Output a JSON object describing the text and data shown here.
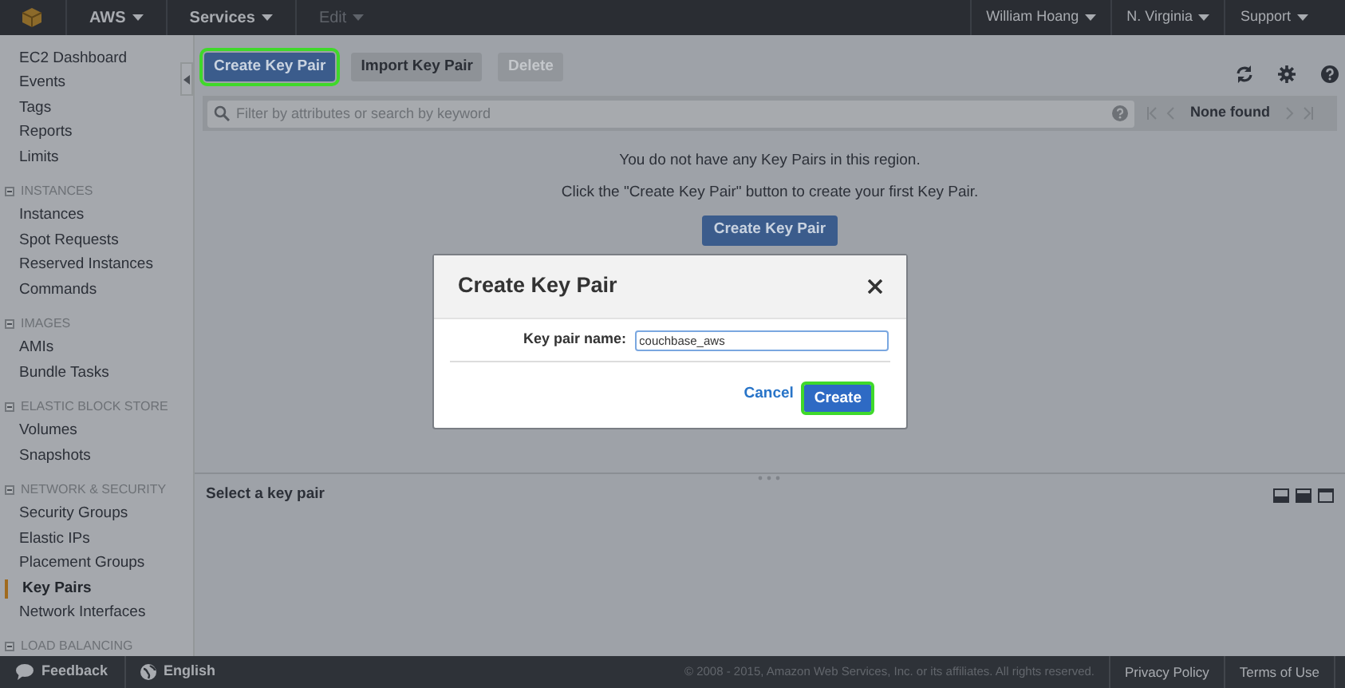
{
  "topbar": {
    "menus": [
      {
        "label": "AWS",
        "disabled": false
      },
      {
        "label": "Services",
        "disabled": false
      },
      {
        "label": "Edit",
        "disabled": true
      }
    ],
    "right_menus": [
      "William Hoang",
      "N. Virginia",
      "Support"
    ]
  },
  "sidebar": {
    "items": [
      {
        "kind": "link",
        "label": "EC2 Dashboard",
        "selected": false
      },
      {
        "kind": "link",
        "label": "Events",
        "selected": false
      },
      {
        "kind": "link",
        "label": "Tags",
        "selected": false
      },
      {
        "kind": "link",
        "label": "Reports",
        "selected": false
      },
      {
        "kind": "link",
        "label": "Limits",
        "selected": false
      },
      {
        "kind": "header",
        "label": "INSTANCES"
      },
      {
        "kind": "link",
        "label": "Instances",
        "selected": false
      },
      {
        "kind": "link",
        "label": "Spot Requests",
        "selected": false
      },
      {
        "kind": "link",
        "label": "Reserved Instances",
        "selected": false
      },
      {
        "kind": "link",
        "label": "Commands",
        "selected": false
      },
      {
        "kind": "header",
        "label": "IMAGES"
      },
      {
        "kind": "link",
        "label": "AMIs",
        "selected": false
      },
      {
        "kind": "link",
        "label": "Bundle Tasks",
        "selected": false
      },
      {
        "kind": "header",
        "label": "ELASTIC BLOCK STORE"
      },
      {
        "kind": "link",
        "label": "Volumes",
        "selected": false
      },
      {
        "kind": "link",
        "label": "Snapshots",
        "selected": false
      },
      {
        "kind": "header",
        "label": "NETWORK & SECURITY"
      },
      {
        "kind": "link",
        "label": "Security Groups",
        "selected": false
      },
      {
        "kind": "link",
        "label": "Elastic IPs",
        "selected": false
      },
      {
        "kind": "link",
        "label": "Placement Groups",
        "selected": false
      },
      {
        "kind": "link",
        "label": "Key Pairs",
        "selected": true
      },
      {
        "kind": "link",
        "label": "Network Interfaces",
        "selected": false
      },
      {
        "kind": "header",
        "label": "LOAD BALANCING"
      }
    ]
  },
  "toolbar": {
    "buttons": [
      {
        "label": "Create Key Pair",
        "kind": "primary",
        "highlighted": true
      },
      {
        "label": "Import Key Pair",
        "kind": "default",
        "highlighted": false
      },
      {
        "label": "Delete",
        "kind": "disabled",
        "highlighted": false
      }
    ]
  },
  "search": {
    "placeholder": "Filter by attributes or search by keyword"
  },
  "pagination": {
    "text": "None found"
  },
  "empty_state": {
    "lines": [
      "You do not have any Key Pairs in this region.",
      "Click the \"Create Key Pair\" button to create your first Key Pair."
    ],
    "button": "Create Key Pair"
  },
  "details": {
    "title": "Select a key pair"
  },
  "dialog": {
    "title": "Create Key Pair",
    "field_label": "Key pair name:",
    "field_value": "couchbase_aws",
    "cancel": "Cancel",
    "submit": "Create",
    "submit_highlighted": true
  },
  "footer": {
    "feedback": "Feedback",
    "language": "English",
    "copyright": "© 2008 - 2015, Amazon Web Services, Inc. or its affiliates. All rights reserved.",
    "links": [
      "Privacy Policy",
      "Terms of Use"
    ]
  }
}
